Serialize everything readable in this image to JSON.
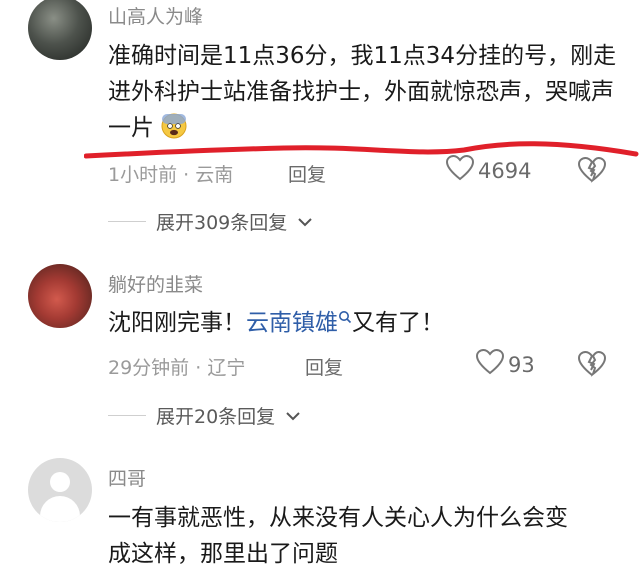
{
  "comments": [
    {
      "username": "山高人为峰",
      "text": "准确时间是11点36分，我11点34分挂的号，刚走进外科护士站准备找护士，外面就惊恐声，哭喊声一片",
      "emoji": "fearful-face",
      "time": "1小时前",
      "location": "云南",
      "reply_label": "回复",
      "likes": "4694",
      "expand_label": "展开309条回复"
    },
    {
      "username": "躺好的韭菜",
      "text_before": "沈阳刚完事！",
      "link_text": "云南镇雄",
      "text_after": "又有了！",
      "time": "29分钟前",
      "location": "辽宁",
      "reply_label": "回复",
      "likes": "93",
      "expand_label": "展开20条回复"
    },
    {
      "username": "四哥",
      "text": "一有事就恶性，从来没有人关心人为什么会变成这样，那里出了问题"
    }
  ],
  "separator": "·",
  "colors": {
    "link": "#2f5ea8",
    "annotation": "#e0202a"
  }
}
